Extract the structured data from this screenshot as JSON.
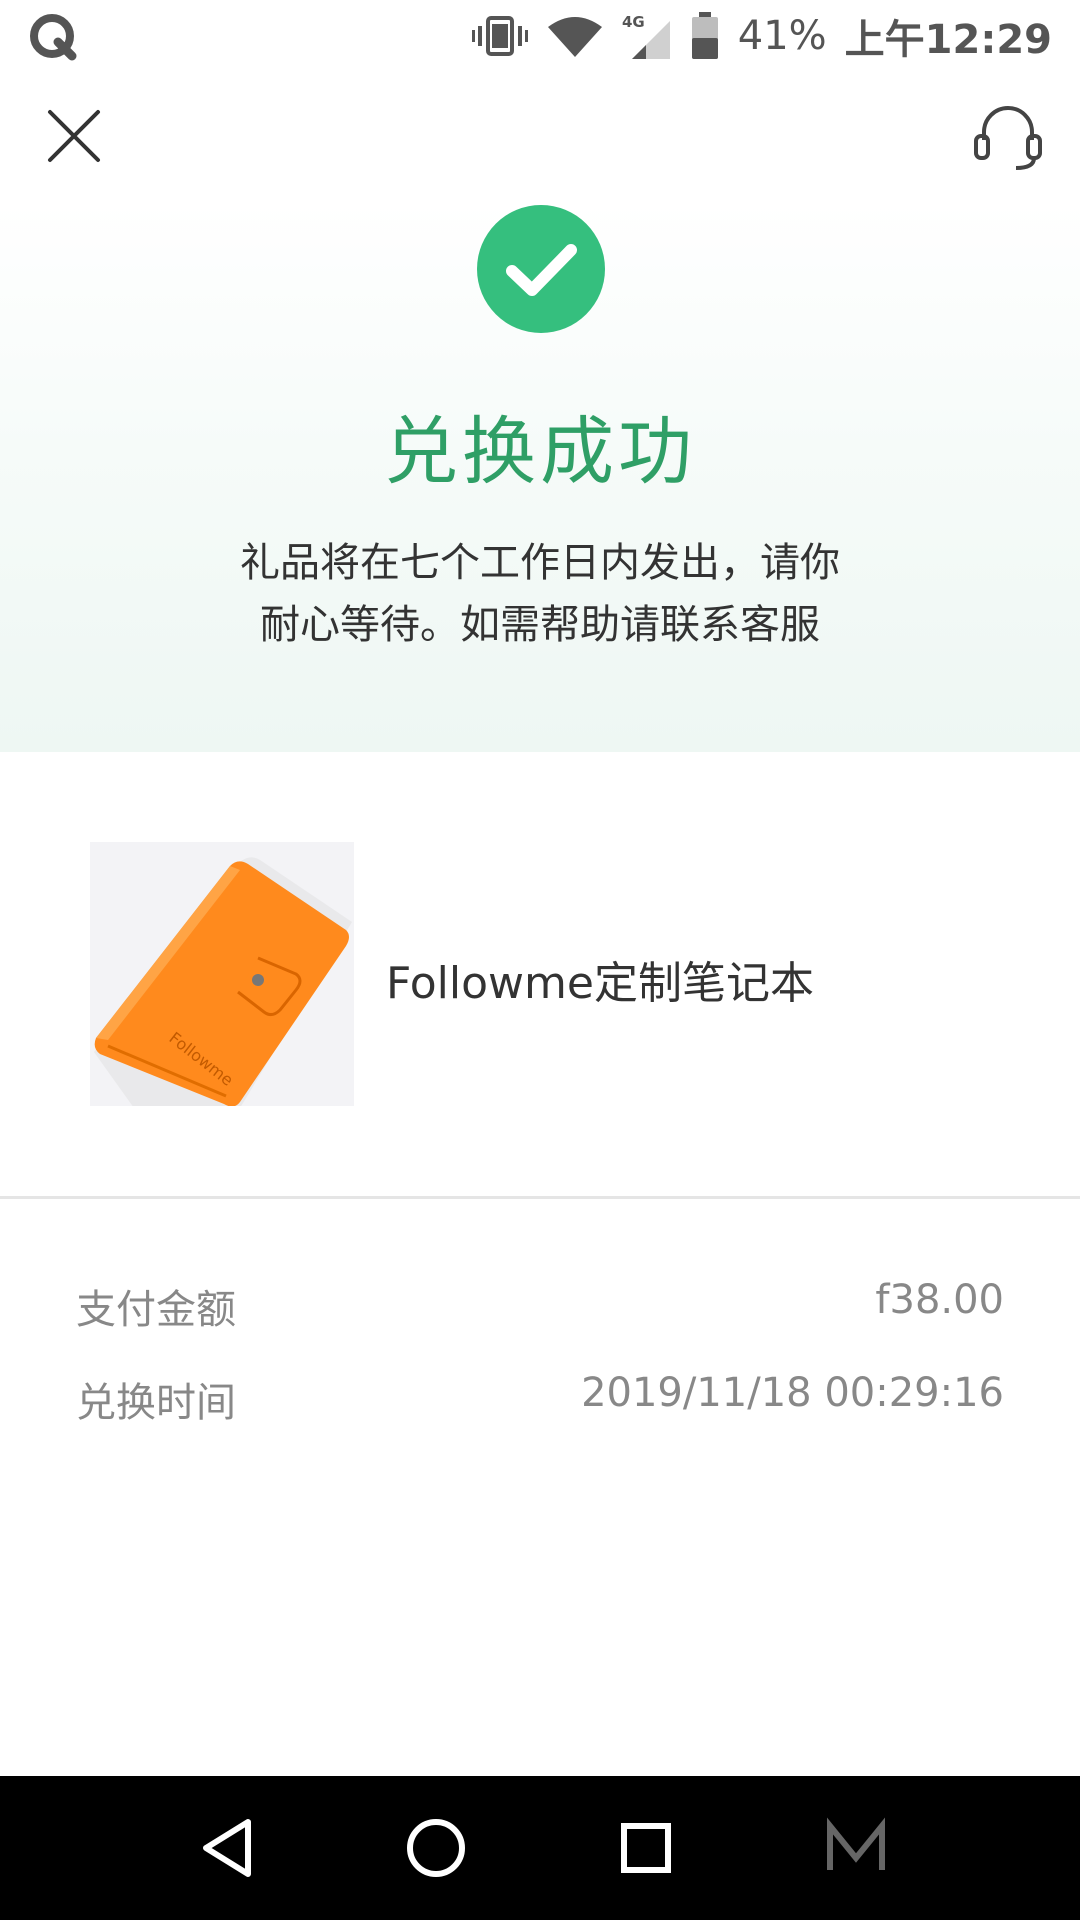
{
  "status_bar": {
    "battery_text": "41%",
    "time": "上午12:29",
    "icons": [
      "app-q-icon",
      "vibrate-icon",
      "wifi-icon",
      "signal-4g-icon",
      "battery-icon"
    ]
  },
  "header": {
    "icons": [
      "close-icon",
      "headset-icon"
    ]
  },
  "success": {
    "icon": "checkmark-circle-icon",
    "color": "#2f9f66",
    "title": "兑换成功",
    "description_line1": "礼品将在七个工作日内发出，请你",
    "description_line2": "耐心等待。如需帮助请联系客服"
  },
  "product": {
    "name": "Followme定制笔记本",
    "image_icon": "orange-notebook-image",
    "image_brand_text": "Followme"
  },
  "details": {
    "payment_label": "支付金额",
    "payment_value": "f38.00",
    "time_label": "兑换时间",
    "time_value": "2019/11/18 00:29:16"
  },
  "nav_bar": {
    "icons": [
      "back-icon",
      "home-icon",
      "recents-icon",
      "menu-m-icon"
    ]
  }
}
